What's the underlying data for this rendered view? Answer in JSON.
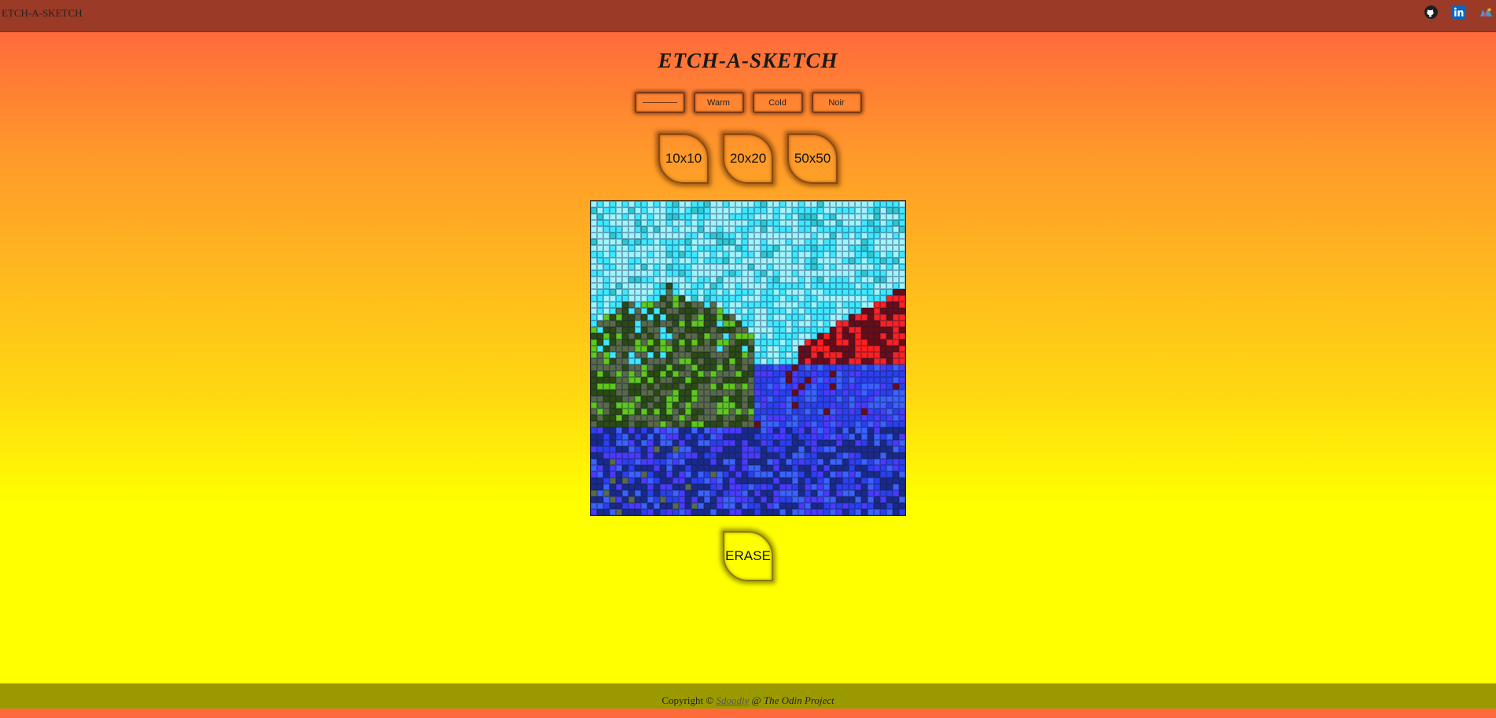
{
  "header": {
    "brand": "ETCH-A-SKETCH",
    "links": [
      {
        "name": "github-icon",
        "color": "#1b1f23"
      },
      {
        "name": "linkedin-icon",
        "color": "#0a66c2"
      },
      {
        "name": "portfolio-icon",
        "color": "#7a5c9c"
      }
    ]
  },
  "title": "ETCH-A-SKETCH",
  "modes": {
    "rainbow_label": "",
    "warm_label": "Warm",
    "cold_label": "Cold",
    "noir_label": "Noir"
  },
  "sizes": {
    "s10_label": "10x10",
    "s20_label": "20x20",
    "s50_label": "50x50"
  },
  "grid": {
    "columns": 50,
    "rows": 50,
    "palette": {
      "sky_light": "#9ff5ff",
      "sky_cyan": "#3ee8ff",
      "sky_teal": "#2ec6cf",
      "mountain_dark": "#2c4a12",
      "mountain_gray": "#5a6a48",
      "mountain_green": "#5fc81a",
      "red": "#ff2020",
      "dark_red": "#6a0c14",
      "blue_navy": "#1a2a8a",
      "blue_mid": "#2a3ff0",
      "blue_violet": "#4a3aff",
      "blue_light": "#3a62ff"
    }
  },
  "erase_label": "ERASE",
  "footer": {
    "copyright": "Copyright ©",
    "author": "Sdoodly",
    "at": "@",
    "project": "The Odin Project"
  }
}
